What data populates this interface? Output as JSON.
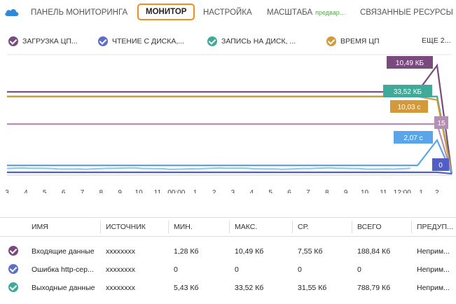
{
  "nav": {
    "tabs": [
      {
        "label": "ПАНЕЛЬ МОНИТОРИНГА"
      },
      {
        "label": "МОНИТОР"
      },
      {
        "label": "НАСТРОЙКА"
      },
      {
        "label": "МАСШТАБА",
        "badge": "предвар..."
      },
      {
        "label": "СВЯЗАННЫЕ РЕСУРСЫ"
      }
    ],
    "active_tab": "МОНИТОР"
  },
  "legend": {
    "items": [
      {
        "label": "ЗАГРУЗКА ЦП...",
        "color": "#7a4a7e"
      },
      {
        "label": "ЧТЕНИЕ С ДИСКА,...",
        "color": "#5b6fc9"
      },
      {
        "label": "ЗАПИСЬ НА ДИСК, ...",
        "color": "#3fa99a"
      },
      {
        "label": "ВРЕМЯ ЦП",
        "color": "#d49a3a"
      }
    ],
    "more_label": "ЕЩЕ 2..."
  },
  "chart_data": {
    "type": "line",
    "x_ticks": [
      "3",
      "4",
      "5",
      "6",
      "7",
      "8",
      "9",
      "10",
      "11",
      "00:00",
      "1",
      "2",
      "3",
      "4",
      "5",
      "6",
      "7",
      "8",
      "9",
      "10",
      "11",
      "12:00",
      "1",
      "2..."
    ],
    "series": [
      {
        "color": "#7a4a7e",
        "value_label": "10,49 КБ",
        "baseline": 0.7,
        "peak": 0.93
      },
      {
        "color": "#3fa99a",
        "value_label": "33,52 КБ",
        "baseline": 0.66,
        "peak": 0.66
      },
      {
        "color": "#d49a3a",
        "value_label": "10,03 с",
        "baseline": 0.66,
        "peak": 0.63
      },
      {
        "color": "#b48fb4",
        "value_label": "15",
        "baseline": 0.42,
        "peak": 0.42
      },
      {
        "color": "#5aa5ea",
        "value_label": "2,07 с",
        "baseline": 0.06,
        "peak": 0.28
      },
      {
        "color": "#4f5fc5",
        "value_label": "0",
        "baseline": 0.0,
        "peak": 0.0
      }
    ],
    "grid": false
  },
  "table": {
    "headers": [
      "ИМЯ",
      "ИСТОЧНИК",
      "МИН.",
      "МАКС.",
      "СР.",
      "ВСЕГО",
      "ПРЕДУП..."
    ],
    "rows": [
      {
        "color": "#7a4a7e",
        "cells": [
          "Входящие данные",
          "xxxxxxxx",
          "1,28 Кб",
          "10,49 Кб",
          "7,55 Кб",
          "188,84 Кб",
          "Неприм..."
        ]
      },
      {
        "color": "#5b6fc9",
        "cells": [
          "Ошибка http-сер...",
          "xxxxxxxx",
          "0",
          "0",
          "0",
          "0",
          "Неприм..."
        ]
      },
      {
        "color": "#3fa99a",
        "cells": [
          "Выходные данные",
          "xxxxxxxx",
          "5,43 Кб",
          "33,52 Кб",
          "31,55 Кб",
          "788,79 Кб",
          "Неприм..."
        ]
      }
    ]
  }
}
